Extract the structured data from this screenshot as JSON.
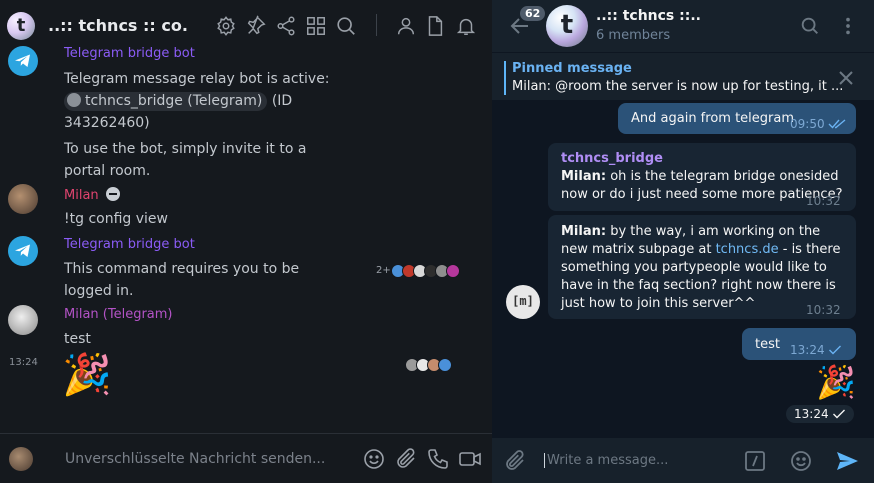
{
  "element": {
    "room": {
      "avatar_letter": "t",
      "name": "..:: tchncs :: co..."
    },
    "header_icons": [
      "settings-icon",
      "pin-icon",
      "share-icon",
      "apps-icon",
      "search-icon",
      "people-icon",
      "files-icon",
      "bell-icon"
    ],
    "timeline": {
      "bot_name": "Telegram bridge bot",
      "bot_intro_line": "Telegram message relay bot is active:",
      "bot_pill": "tchncs_bridge (Telegram)",
      "bot_id_text": " (ID",
      "bot_id_number": "343262460)",
      "bot_usage": "To use the bot, simply invite it to a portal room.",
      "milan_name": "Milan",
      "milan_msg": "!tg config view",
      "bot_name_2": "Telegram bridge bot",
      "bot_reply": "This command requires you to be logged in.",
      "receipt_count": "2+",
      "milan_tg_name": "Milan (Telegram)",
      "milan_tg_msg": "test",
      "timestamp": "13:24",
      "party_emoji": "🎉"
    },
    "composer": {
      "placeholder": "Unverschlüsselte Nachricht senden..."
    },
    "colors": {
      "bot_name": "#8b5cf6",
      "milan": "#e0446f",
      "milan_tg": "#b353c6",
      "accent": "#2ca5e0"
    }
  },
  "telegram": {
    "chat": {
      "avatar_letter": "t",
      "title": "..:: tchncs ::..",
      "subtitle": "6 members",
      "unread_count": "62"
    },
    "pinned": {
      "title": "Pinned message",
      "text": "Milan: @room the server is now up for testing, it ..."
    },
    "messages": [
      {
        "text": "And again from telegram",
        "time": "09:50"
      },
      {
        "sender": "tchncs_bridge",
        "from": "Milan:",
        "text": "oh is the telegram bridge onesided now or do i just need some more patience?",
        "time": "10:32"
      },
      {
        "from": "Milan:",
        "text_before": "by the way, i am working on the new matrix subpage at ",
        "link": "tchncs.de",
        "text_after": " - is there something you partypeople would like to have in the faq section? right now there is just how to join this server^^",
        "time": "10:32"
      },
      {
        "text": "test",
        "time": "13:24"
      },
      {
        "sticker": "🎉",
        "time": "13:24"
      }
    ],
    "matrix_avatar_label": "[m]",
    "composer": {
      "placeholder": "Write a message..."
    },
    "colors": {
      "outgoing": "#2b5278",
      "incoming": "#182533",
      "link": "#71baf5",
      "sender": "#b08ef5"
    }
  }
}
